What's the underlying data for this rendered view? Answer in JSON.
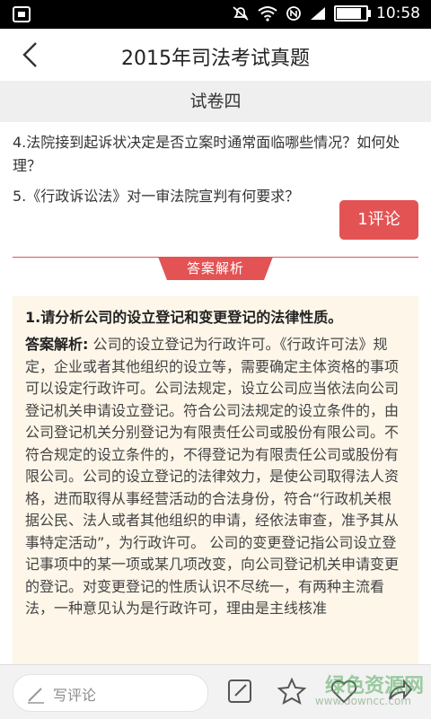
{
  "status": {
    "time": "10:58"
  },
  "header": {
    "title": "2015年司法考试真题"
  },
  "paper": {
    "name": "试卷四"
  },
  "questions": [
    "4.法院接到起诉状决定是否立案时通常面临哪些情况？如何处理？",
    "5.《行政诉讼法》对一审法院宣判有何要求？"
  ],
  "comment_button": "1评论",
  "answer_section": {
    "label": "答案解析"
  },
  "answer": {
    "question": "1.请分析公司的设立登记和变更登记的法律性质。",
    "prefix": "答案解析:",
    "text": " 公司的设立登记为行政许可。《行政许可法》规定，企业或者其他组织的设立等，需要确定主体资格的事项可以设定行政许可。公司法规定，设立公司应当依法向公司登记机关申请设立登记。符合公司法规定的设立条件的，由公司登记机关分别登记为有限责任公司或股份有限公司。不符合规定的设立条件的，不得登记为有限责任公司或股份有限公司。公司的设立登记的法律效力，是使公司取得法人资格，进而取得从事经营活动的合法身份，符合“行政机关根据公民、法人或者其他组织的申请，经依法审查，准予其从事特定活动”，为行政许可。 公司的变更登记指公司设立登记事项中的某一项或某几项改变，向公司登记机关申请变更的登记。对变更登记的性质认识不尽统一，有两种主流看法，一种意见认为是行政许可，理由是主线核准"
  },
  "bottom": {
    "write_placeholder": "写评论"
  },
  "watermark": {
    "text": "绿色资源网",
    "url": "www.downcc.com"
  },
  "colors": {
    "accent": "#e35354",
    "answer_bg": "#fdf6e9"
  }
}
